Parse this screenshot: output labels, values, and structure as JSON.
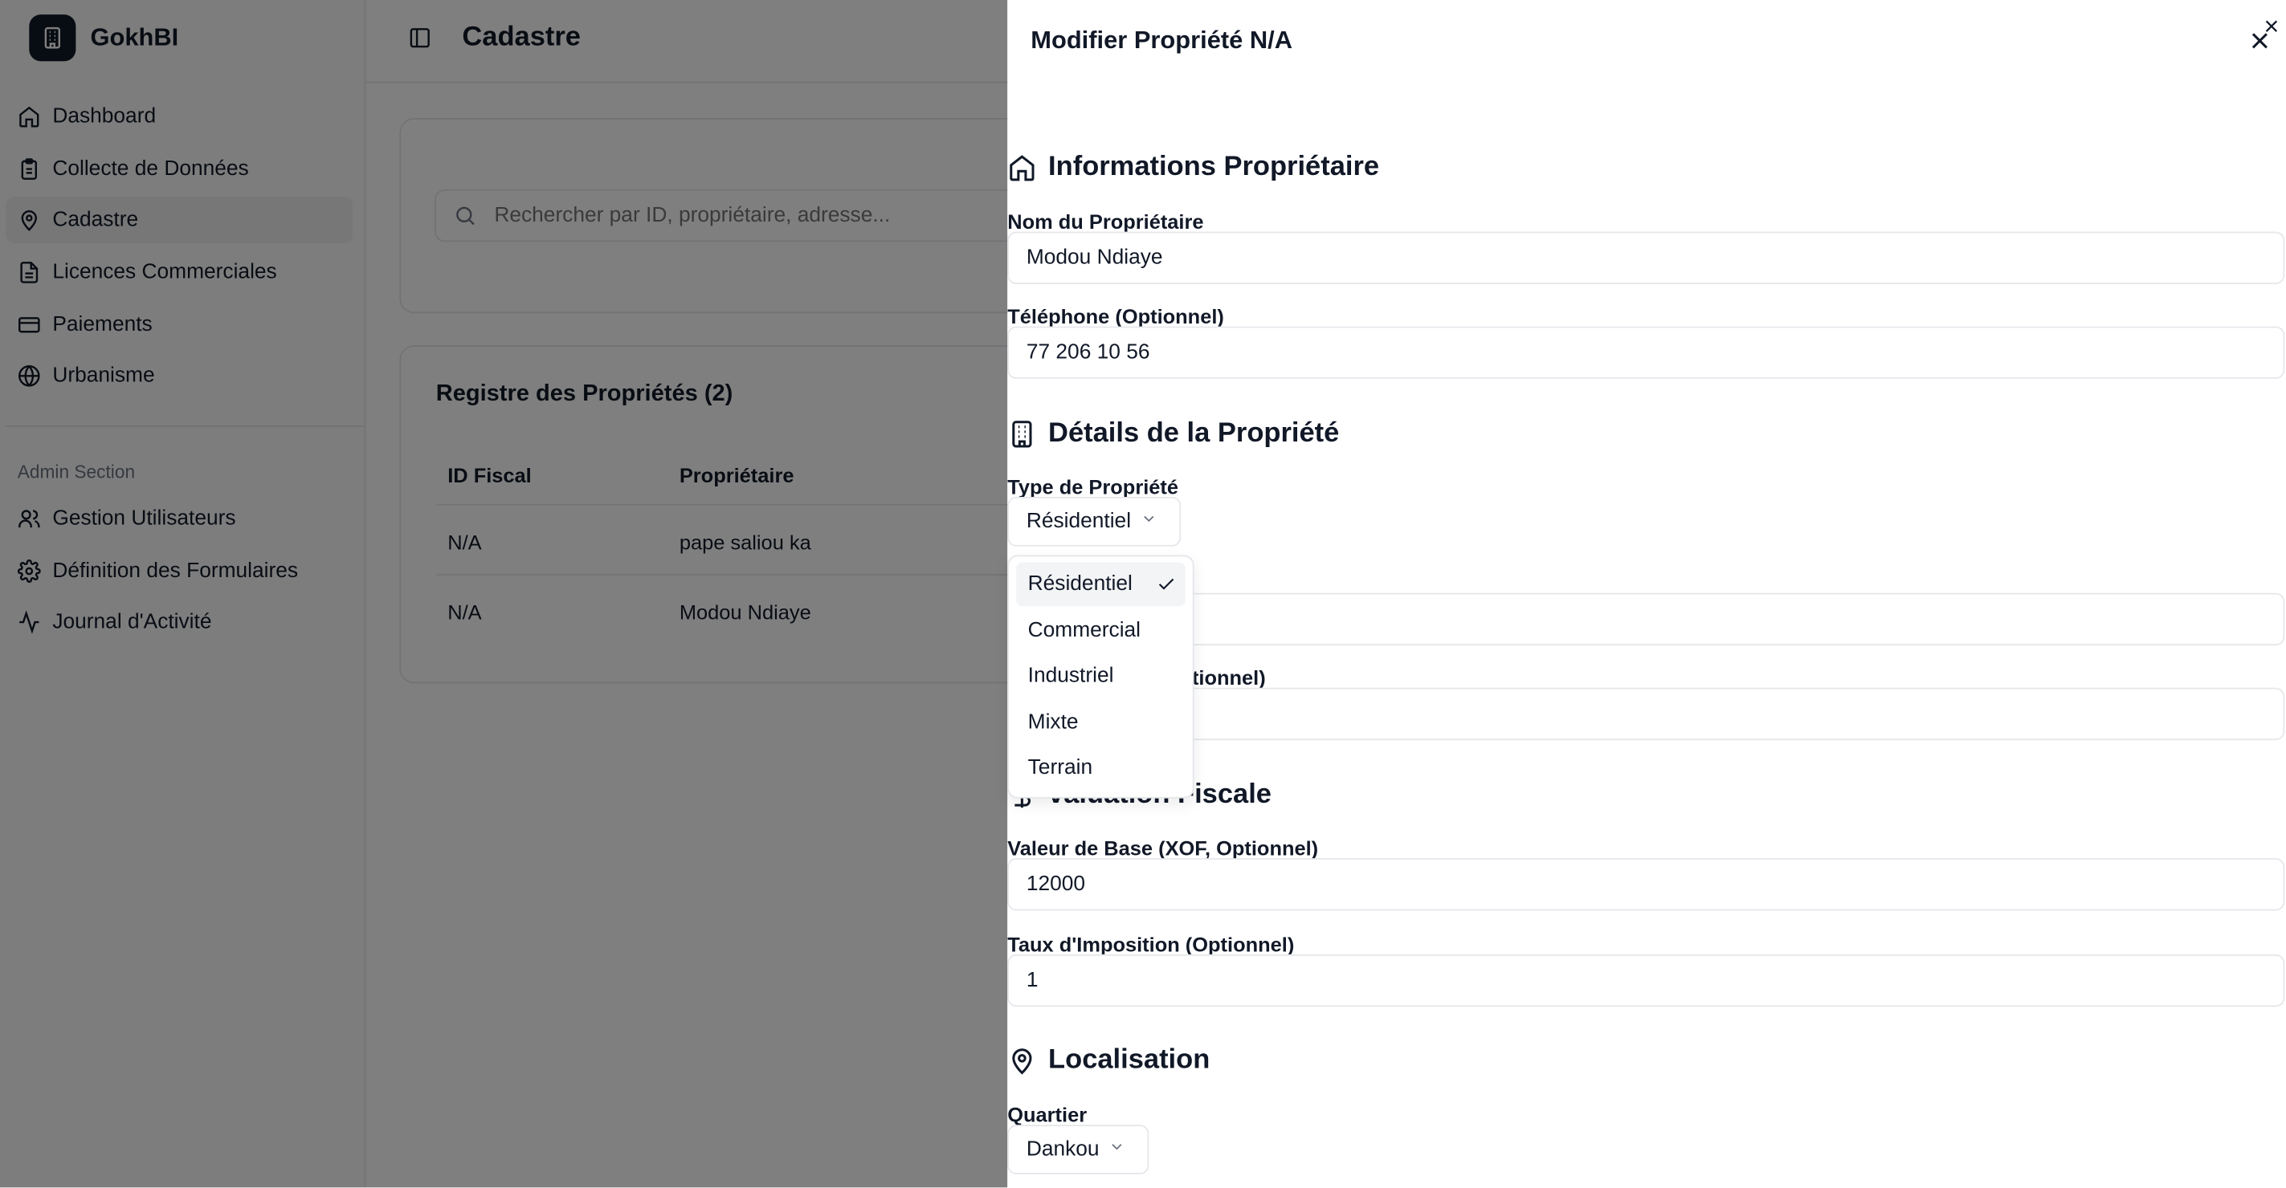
{
  "app": {
    "name": "GokhBI"
  },
  "sidebar": {
    "items": [
      {
        "label": "Dashboard",
        "icon": "home-icon"
      },
      {
        "label": "Collecte de Données",
        "icon": "clipboard-icon"
      },
      {
        "label": "Cadastre",
        "icon": "map-pin-icon",
        "active": true
      },
      {
        "label": "Licences Commerciales",
        "icon": "file-icon"
      },
      {
        "label": "Paiements",
        "icon": "credit-card-icon"
      },
      {
        "label": "Urbanisme",
        "icon": "globe-icon"
      }
    ],
    "admin_label": "Admin Section",
    "admin_items": [
      {
        "label": "Gestion Utilisateurs",
        "icon": "users-icon"
      },
      {
        "label": "Définition des Formulaires",
        "icon": "gear-icon"
      },
      {
        "label": "Journal d'Activité",
        "icon": "activity-icon"
      }
    ]
  },
  "header": {
    "title": "Cadastre"
  },
  "search": {
    "placeholder": "Rechercher par ID, propriétaire, adresse..."
  },
  "registry": {
    "title": "Registre des Propriétés (2)",
    "columns": [
      "ID Fiscal",
      "Propriétaire"
    ],
    "rows": [
      [
        "N/A",
        "pape saliou ka"
      ],
      [
        "N/A",
        "Modou Ndiaye"
      ]
    ]
  },
  "panel": {
    "title": "Modifier Propriété N/A",
    "owner_section": "Informations Propriétaire",
    "owner_name_label": "Nom du Propriétaire",
    "owner_name_value": "Modou Ndiaye",
    "phone_label": "Téléphone (Optionnel)",
    "phone_value": "77 206 10 56",
    "details_section": "Détails de la Propriété",
    "type_label": "Type de Propriété",
    "type_value": "Résidentiel",
    "hidden_label_1_tail": ")",
    "hidden_label_2_tail": "ptionnel)",
    "fiscal_section_visible": "valuation Fiscale",
    "base_value_label": "Valeur de Base (XOF, Optionnel)",
    "base_value": "12000",
    "tax_rate_label": "Taux d'Imposition (Optionnel)",
    "tax_rate_value": "1",
    "location_section": "Localisation",
    "quartier_label": "Quartier",
    "quartier_value": "Dankou"
  },
  "dropdown": {
    "options": [
      "Résidentiel",
      "Commercial",
      "Industriel",
      "Mixte",
      "Terrain"
    ],
    "selected": "Résidentiel"
  }
}
